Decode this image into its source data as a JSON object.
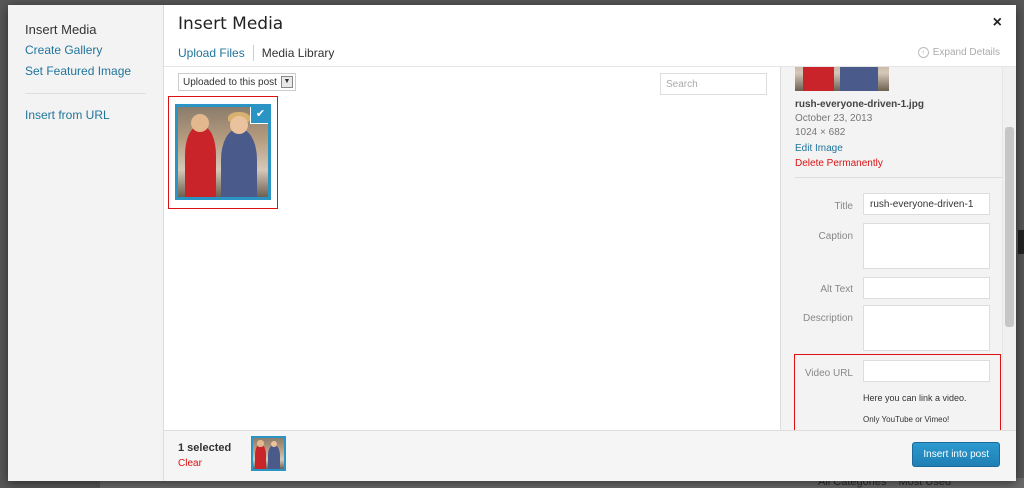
{
  "background": {
    "links": [
      "All Categories",
      "Most Used"
    ]
  },
  "modal": {
    "title": "Insert Media",
    "close_glyph": "×"
  },
  "menu": {
    "items": [
      {
        "label": "Insert Media"
      },
      {
        "label": "Create Gallery"
      },
      {
        "label": "Set Featured Image"
      },
      {
        "label": "Insert from URL"
      }
    ]
  },
  "router": {
    "tabs": [
      {
        "label": "Upload Files"
      },
      {
        "label": "Media Library"
      }
    ],
    "expand_label": "Expand Details",
    "expand_icon": "‹"
  },
  "toolbar": {
    "filter_value": "Uploaded to this post",
    "filter_arrow": "▼",
    "search_placeholder": "Search"
  },
  "attachment": {
    "check_glyph": "✔"
  },
  "details": {
    "filename": "rush-everyone-driven-1.jpg",
    "date": "October 23, 2013",
    "dimensions": "1024 × 682",
    "edit_label": "Edit Image",
    "delete_label": "Delete Permanently"
  },
  "fields": {
    "title_label": "Title",
    "title_value": "rush-everyone-driven-1",
    "caption_label": "Caption",
    "alt_label": "Alt Text",
    "description_label": "Description",
    "video_label": "Video URL",
    "video_help": "Here you can link a video.",
    "video_note": "Only YouTube or Vimeo!"
  },
  "bottom": {
    "selected": "1 selected",
    "clear_label": "Clear",
    "insert_label": "Insert into post"
  },
  "colors": {
    "accent": "#2a95c5",
    "link": "#21759b",
    "danger": "#dd1111"
  }
}
